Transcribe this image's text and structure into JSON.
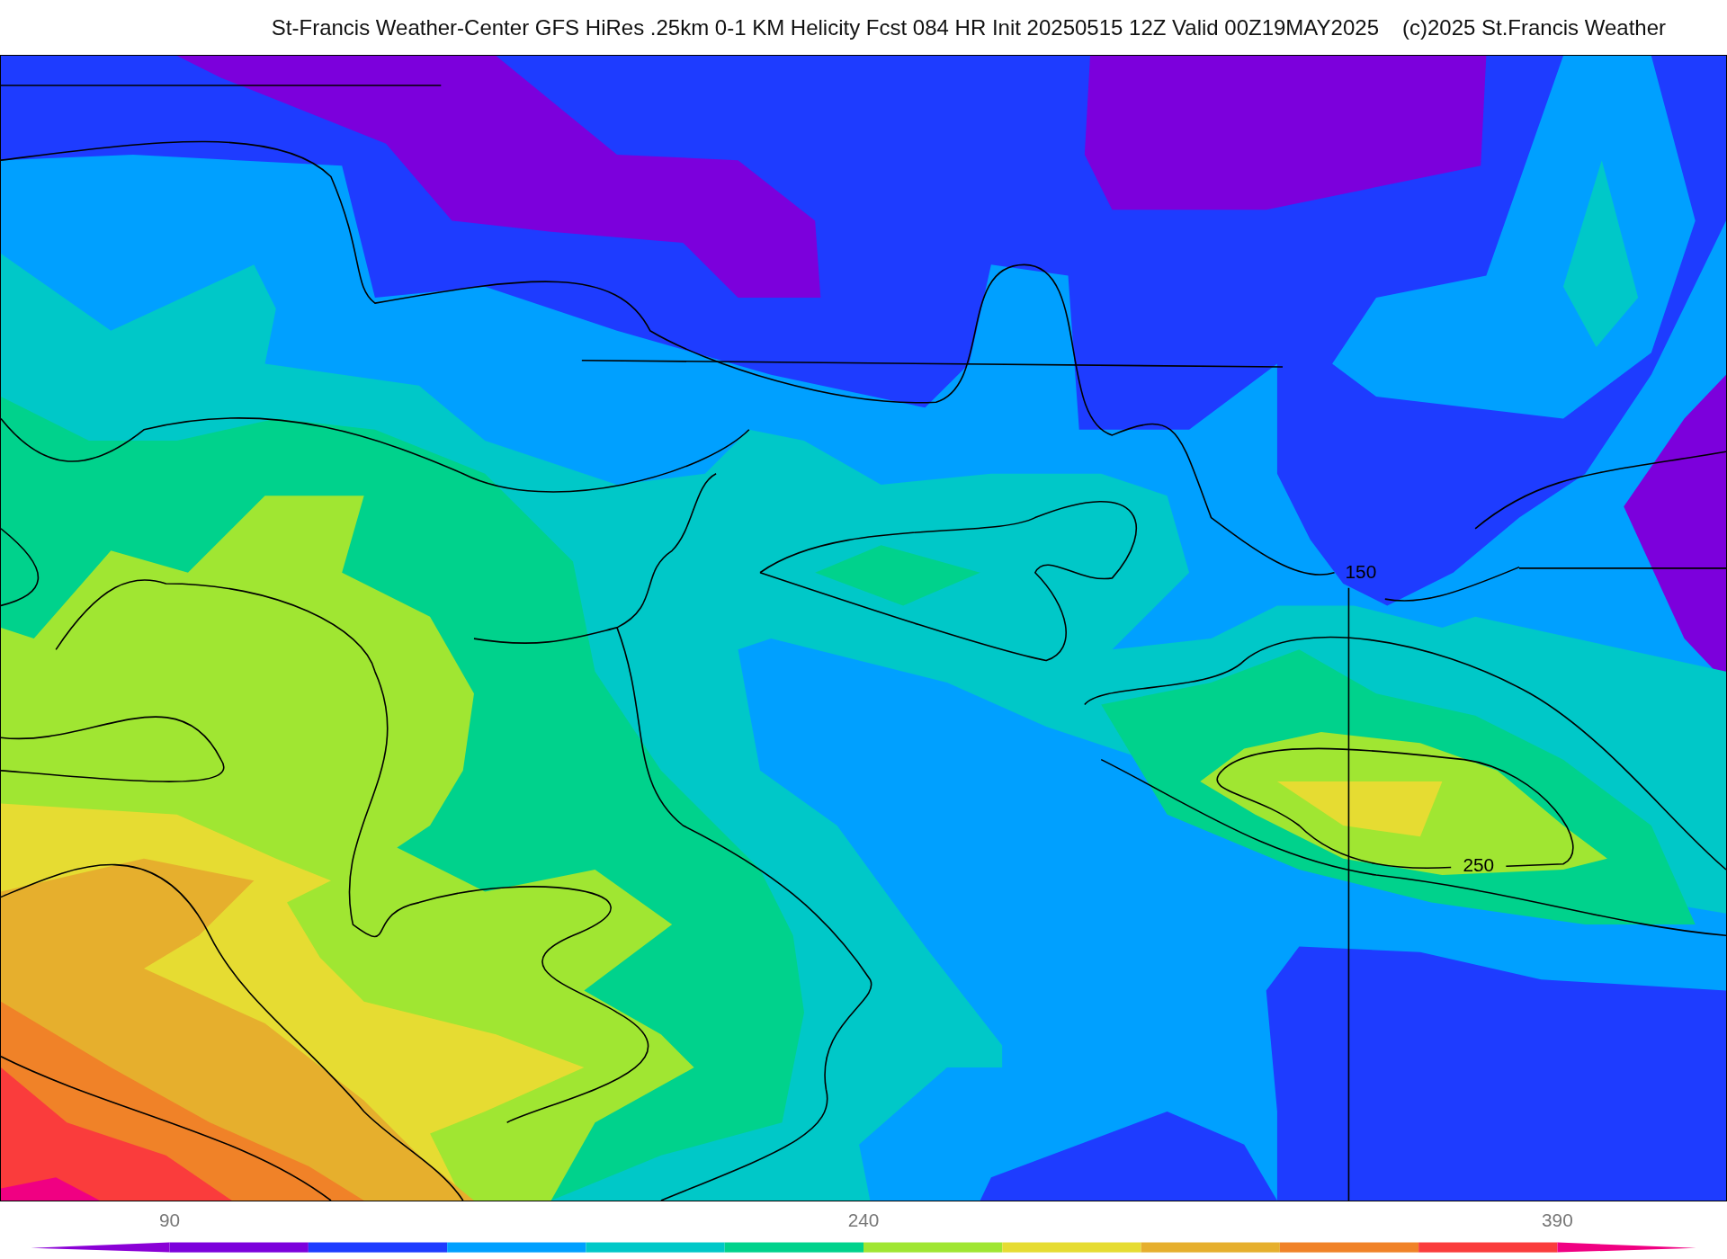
{
  "header": {
    "title": "St-Francis Weather-Center GFS HiRes .25km 0-1 KM Helicity Fcst 084 HR Init 20250515 12Z  Valid 00Z19MAY2025",
    "credit": "(c)2025 St.Francis Weather"
  },
  "map": {
    "contour_labels": [
      "150",
      "250"
    ]
  },
  "colorbar": [
    {
      "kind": "arrow",
      "color": "#8a00d6"
    },
    {
      "kind": "bin",
      "color": "#7c00dc",
      "tick": "90"
    },
    {
      "kind": "bin",
      "color": "#1e3cff"
    },
    {
      "kind": "bin",
      "color": "#00a0ff"
    },
    {
      "kind": "bin",
      "color": "#00c8c8"
    },
    {
      "kind": "bin",
      "color": "#00d28c"
    },
    {
      "kind": "bin",
      "color": "#a0e632",
      "tick": "240"
    },
    {
      "kind": "bin",
      "color": "#e6dc32"
    },
    {
      "kind": "bin",
      "color": "#e6af2d"
    },
    {
      "kind": "bin",
      "color": "#f08228"
    },
    {
      "kind": "bin",
      "color": "#fa3c3c"
    },
    {
      "kind": "arrow",
      "color": "#f00082",
      "tick": "390"
    }
  ]
}
